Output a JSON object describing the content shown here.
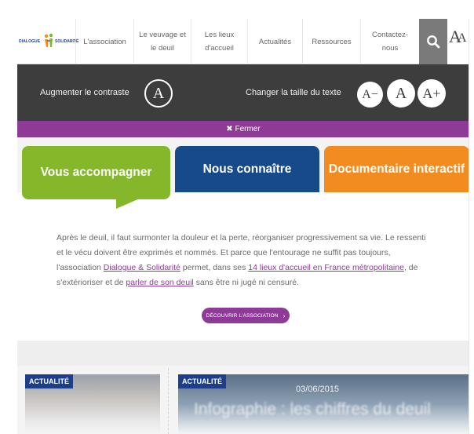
{
  "header": {
    "logo_text_left": "DIALOGUE",
    "logo_text_right": "SOLIDARITÉ",
    "nav": [
      {
        "line1": "L'association",
        "line2": ""
      },
      {
        "line1": "Le veuvage et",
        "line2": "le deuil"
      },
      {
        "line1": "Les lieux",
        "line2": "d'accueil"
      },
      {
        "line1": "Actualités",
        "line2": ""
      },
      {
        "line1": "Ressources",
        "line2": ""
      },
      {
        "line1": "Contactez-nous",
        "line2": ""
      }
    ],
    "search_icon": "search-icon",
    "text_size_icon": "text-size-icon",
    "aa_big": "A",
    "aa_small": "A"
  },
  "accessibility": {
    "contrast_label": "Augmenter le contraste",
    "contrast_button": "A",
    "text_size_label": "Changer la taille du texte",
    "decrease_button": "A−",
    "reset_button": "A",
    "increase_button": "A+",
    "close_label": "✖ Fermer"
  },
  "tabs": [
    {
      "label": "Vous accompagner",
      "color": "#84b82a"
    },
    {
      "label": "Nous connaître",
      "color": "#174a8b"
    },
    {
      "label": "Documentaire interactif",
      "color": "#f28c20"
    }
  ],
  "intro": {
    "part1": "Après le deuil, il faut surmonter la douleur et la perte, réorganiser progressivement sa vie. Le ressenti et le vécu doivent être exprimés et nommés. Et parce que l'entourage ne suffit pas toujours, l'association ",
    "link1": "Dialogue & Solidarité",
    "part2": " permet, dans ses ",
    "link2": "14 lieux d'accueil en France métropolitaine",
    "part3": ", de s'extérioriser et de ",
    "link3": "parler de son deuil",
    "part4": " sans être ni jugé ni censuré."
  },
  "cta": {
    "label": "DÉCOUVRIR L'ASSOCIATION",
    "icon": "chevron-right-icon"
  },
  "news": [
    {
      "badge": "ACTUALITÉ",
      "date": "",
      "title": ""
    },
    {
      "badge": "ACTUALITÉ",
      "date": "03/06/2015",
      "title": "Infographie : les chiffres du deuil"
    }
  ],
  "colors": {
    "purple": "#8e3a97",
    "dark_bar": "#3d3d3d",
    "navy": "#1d3f8a"
  }
}
